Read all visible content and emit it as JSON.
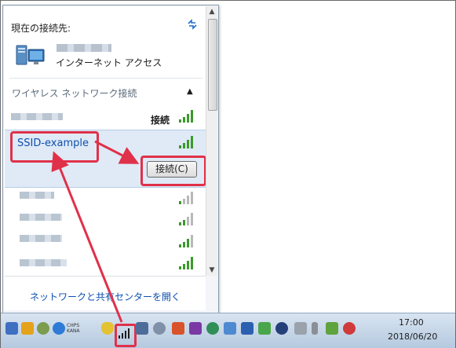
{
  "popup": {
    "current_connection_label": "現在の接続先:",
    "internet_access_label": "インターネット アクセス",
    "wireless_section_label": "ワイヤレス ネットワーク接続",
    "connected_status": "接続",
    "selected_ssid": "SSID-example",
    "connect_button_label": "接続(C)",
    "network_center_link": "ネットワークと共有センターを開く"
  },
  "taskbar": {
    "input_indicator": [
      "CHPS",
      "KANA"
    ],
    "clock_time": "17:00",
    "clock_date": "2018/06/20"
  },
  "colors": {
    "highlight_red": "#e0314a",
    "link_blue": "#0c4fb0",
    "selected_row": "#dfeaf6",
    "signal_green": "#3a9a2a"
  }
}
